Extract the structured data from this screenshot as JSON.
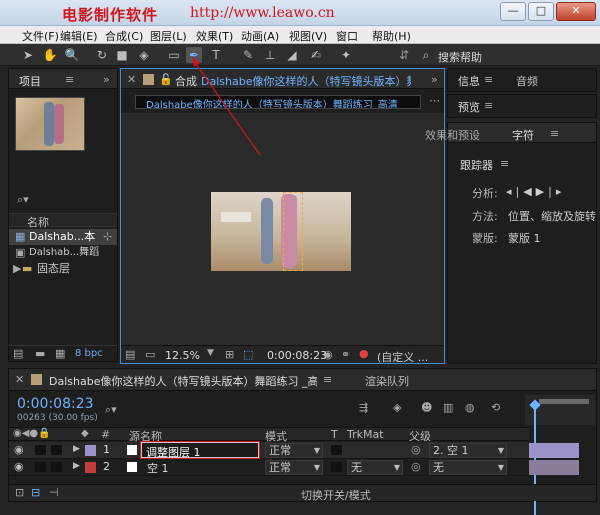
{
  "watermark": {
    "brand": "电影制作软件",
    "url": "http://www.leawo.cn"
  },
  "window": {
    "minimize": "—",
    "maximize": "□",
    "close": "✕"
  },
  "menu": [
    "文件(F)",
    "编辑(E)",
    "合成(C)",
    "图层(L)",
    "效果(T)",
    "动画(A)",
    "视图(V)",
    "窗口",
    "帮助(H)"
  ],
  "toolbar": {
    "search_label": "搜索帮助",
    "icons": [
      "selection-icon",
      "hand-icon",
      "zoom-icon",
      "rotate-icon",
      "camera-icon",
      "pan-behind-icon",
      "rectangle-icon",
      "pen-icon",
      "type-icon",
      "brush-icon",
      "stamp-icon",
      "eraser-icon",
      "roto-brush-icon",
      "puppet-icon"
    ]
  },
  "project": {
    "tab": "项目",
    "column_name": "名称",
    "items": [
      {
        "name": "Dalshab...本",
        "selected": true
      },
      {
        "name": "Dalshab...舞蹈"
      },
      {
        "name": "固态层",
        "folder": true
      }
    ],
    "bpc": "8 bpc"
  },
  "composition": {
    "tab_prefix": "合成",
    "tab_title": "Dalshabe像你这样的人（特写镜头版本）舞蹈",
    "breadcrumb": "Dalshabe像你这样的人（特写镜头版本）舞蹈练习_高清",
    "zoom": "12.5%",
    "timecode": "0:00:08:23",
    "view": "(自定义 ..."
  },
  "right": {
    "tabs_top": [
      "信息",
      "音频"
    ],
    "preview": "预览",
    "tabs_mid": [
      "效果和预设",
      "字符"
    ],
    "tracker": {
      "title": "跟踪器",
      "analyze_label": "分析:",
      "method_label": "方法:",
      "method_value": "位置、缩放及旋转",
      "mask_label": "蒙版:",
      "mask_value": "蒙版 1"
    }
  },
  "timeline": {
    "tab": "Dalshabe像你这样的人（特写镜头版本）舞蹈练习 _高清",
    "render_tab": "渲染队列",
    "timecode": "0:00:08:23",
    "frames": "00263 (30.00 fps)",
    "columns": {
      "num": "#",
      "name": "源名称",
      "mode": "模式",
      "t": "T",
      "trkmat": "TrkMat",
      "parent": "父级"
    },
    "layers": [
      {
        "num": "1",
        "name": "调整图层 1",
        "mode": "正常",
        "trkmat": "",
        "parent": "2. 空 1",
        "color": "#9b93c9"
      },
      {
        "num": "2",
        "name": "空 1",
        "mode": "正常",
        "trkmat": "无",
        "parent": "无",
        "color": "#c33b3b"
      }
    ],
    "switch_label": "切换开关/模式"
  }
}
